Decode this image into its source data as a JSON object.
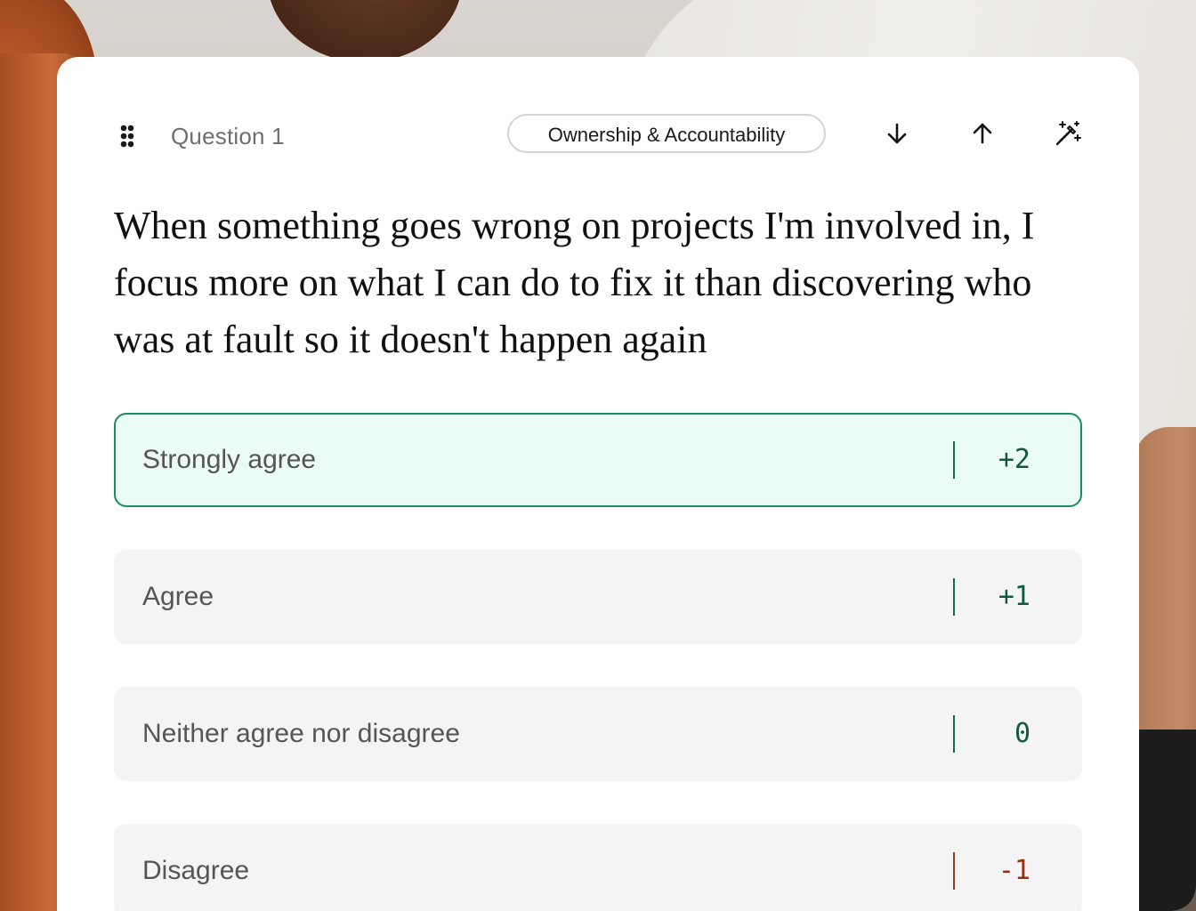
{
  "question": {
    "number_label": "Question 1",
    "category": "Ownership & Accountability",
    "text": "When something goes wrong on projects I'm involved in, I focus more on what I can do to fix it than discovering who was at fault so it doesn't happen again"
  },
  "toolbar": {
    "icons": [
      "drag-handle-icon",
      "arrow-down-icon",
      "arrow-up-icon",
      "magic-wand-icon"
    ]
  },
  "options": [
    {
      "label": "Strongly agree",
      "score": "+2",
      "selected": true
    },
    {
      "label": "Agree",
      "score": "+1",
      "selected": false
    },
    {
      "label": "Neither agree nor disagree",
      "score": "0",
      "selected": false
    },
    {
      "label": "Disagree",
      "score": "-1",
      "selected": false
    }
  ],
  "colors": {
    "selected_border": "#1a8c63",
    "selected_bg": "#eafcf3",
    "positive_score": "#0f5a3e",
    "negative_score": "#9a2f10",
    "option_bg": "#f4f4f4"
  }
}
